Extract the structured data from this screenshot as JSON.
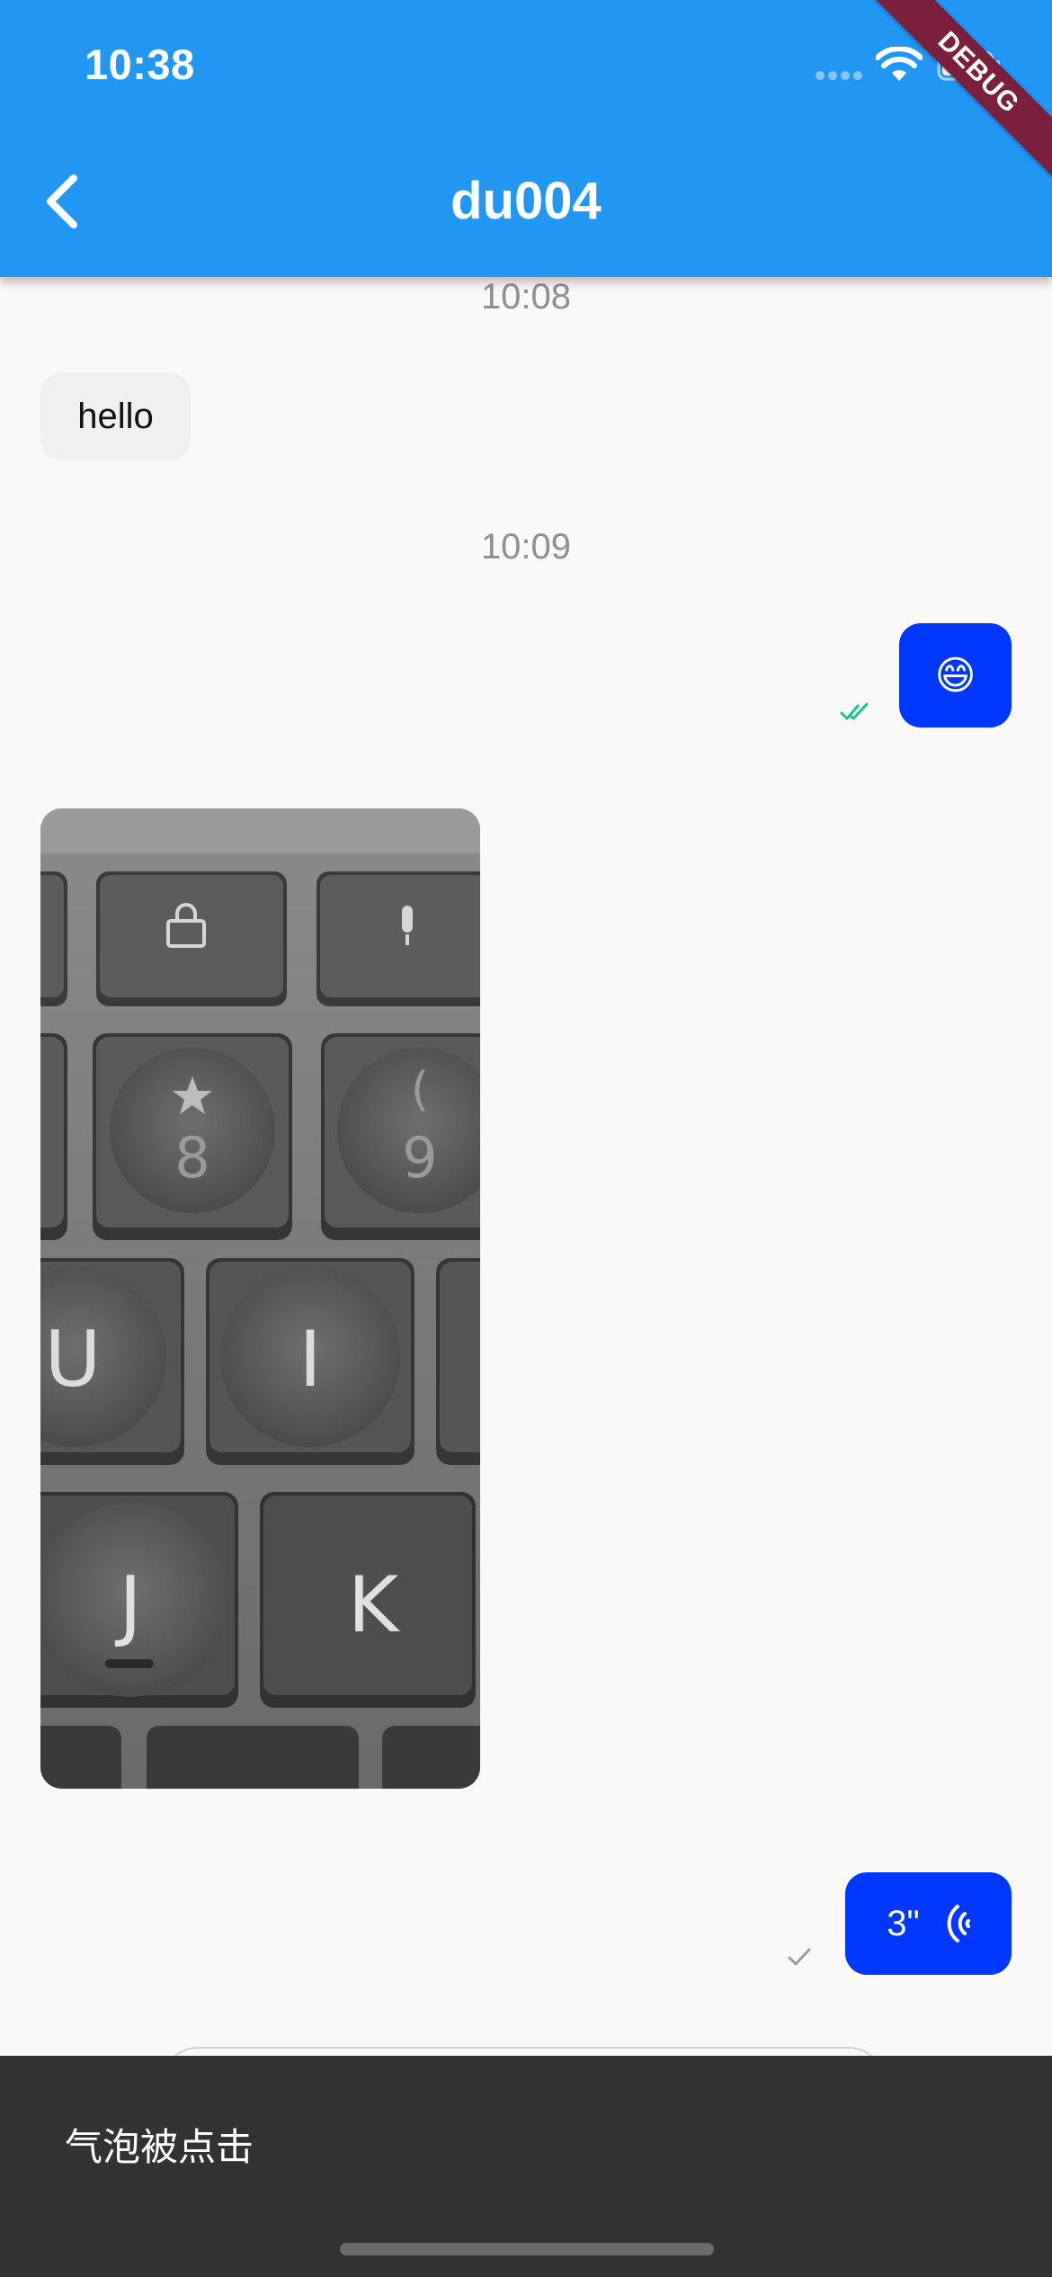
{
  "status_bar": {
    "time": "10:38"
  },
  "header": {
    "title": "du004"
  },
  "debug_banner": "DEBUG",
  "messages": {
    "time_1": "10:08",
    "text_1": "hello",
    "time_2": "10:09",
    "emoji_1": "😄",
    "voice_duration": "3\""
  },
  "snackbar": {
    "text": "气泡被点击"
  },
  "colors": {
    "app_bar": "#2196f3",
    "sent_bubble": "#0037ff",
    "received_bubble": "#f0f0f0",
    "read_check": "#1ec28b",
    "snackbar": "#323232"
  }
}
